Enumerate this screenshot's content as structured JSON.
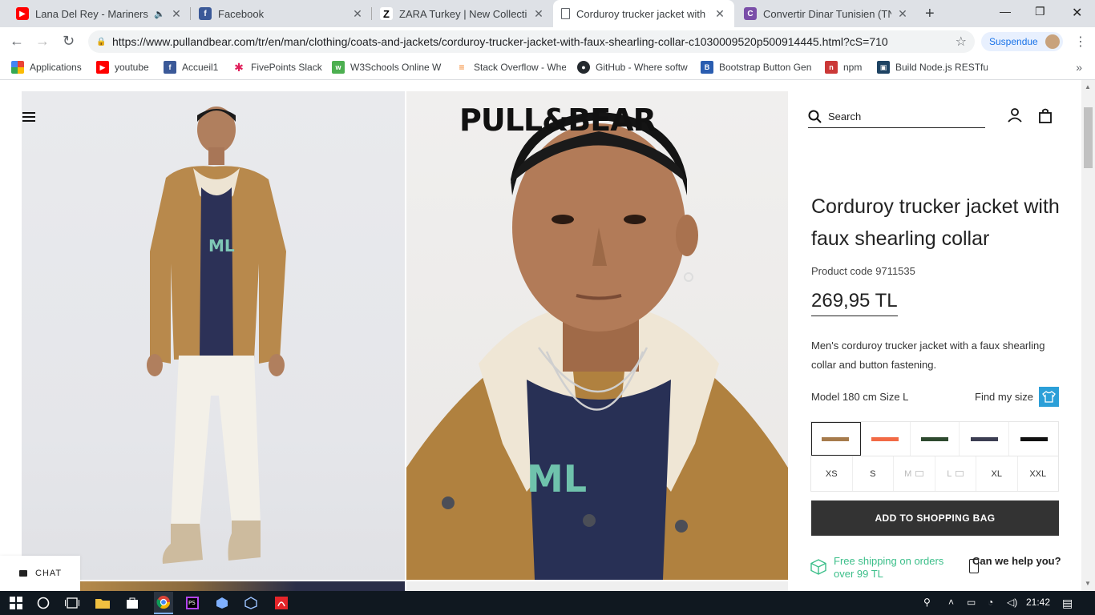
{
  "browser": {
    "tabs": [
      {
        "title": "Lana Del Rey - Mariners Ap",
        "favicon": "youtube-icon",
        "color": "#ff0000"
      },
      {
        "title": "Facebook",
        "favicon": "facebook-icon",
        "color": "#3b5998"
      },
      {
        "title": "ZARA Turkey | New Collection",
        "favicon": "zara-icon",
        "color": "#000000"
      },
      {
        "title": "Corduroy trucker jacket with fa",
        "favicon": "page-icon",
        "color": "#5f6368"
      },
      {
        "title": "Convertir Dinar Tunisien (TND)",
        "favicon": "currency-icon",
        "color": "#7a4ea8"
      }
    ],
    "url": "https://www.pullandbear.com/tr/en/man/clothing/coats-and-jackets/corduroy-trucker-jacket-with-faux-shearling-collar-c1030009520p500914445.html?cS=710",
    "profile_label": "Suspendue",
    "bookmarks": [
      {
        "label": "Applications",
        "icon": "apps-grid-icon",
        "color": "#ea4335"
      },
      {
        "label": "youtube",
        "icon": "youtube-icon",
        "color": "#ff0000"
      },
      {
        "label": "Accueil1",
        "icon": "facebook-icon",
        "color": "#3b5998"
      },
      {
        "label": "FivePoints Slack",
        "icon": "slack-icon",
        "color": "#e01e5a"
      },
      {
        "label": "W3Schools Online W",
        "icon": "w3schools-icon",
        "color": "#4caf50"
      },
      {
        "label": "Stack Overflow - Whe",
        "icon": "stackoverflow-icon",
        "color": "#f48024"
      },
      {
        "label": "GitHub - Where softw",
        "icon": "github-icon",
        "color": "#24292e"
      },
      {
        "label": "Bootstrap Button Gen",
        "icon": "bootstrap-icon",
        "color": "#2a5db0"
      },
      {
        "label": "npm",
        "icon": "npm-icon",
        "color": "#cb3837"
      },
      {
        "label": "Build Node.js RESTful",
        "icon": "node-icon",
        "color": "#1e4363"
      }
    ]
  },
  "site": {
    "logo": "PULL&BEAR",
    "search_placeholder": "Search",
    "chat_label": "CHAT"
  },
  "product": {
    "title": "Corduroy trucker jacket with faux shearling collar",
    "code": "Product code 9711535",
    "price": "269,95 TL",
    "description": "Men's corduroy trucker jacket with a faux shearling collar and button fastening.",
    "model_info": "Model 180 cm Size L",
    "find_size": "Find my size",
    "colors": [
      "#a67b4c",
      "#f26a45",
      "#2e4a2f",
      "#3c3e52",
      "#111111"
    ],
    "sizes": [
      {
        "label": "XS",
        "available": true
      },
      {
        "label": "S",
        "available": true
      },
      {
        "label": "M",
        "available": false
      },
      {
        "label": "L",
        "available": false
      },
      {
        "label": "XL",
        "available": true
      },
      {
        "label": "XXL",
        "available": true
      }
    ],
    "add_to_bag": "ADD TO SHOPPING BAG",
    "shipping": "Free shipping on orders over 99 TL",
    "help": "Can we help you?"
  },
  "taskbar": {
    "time": "21:42"
  }
}
